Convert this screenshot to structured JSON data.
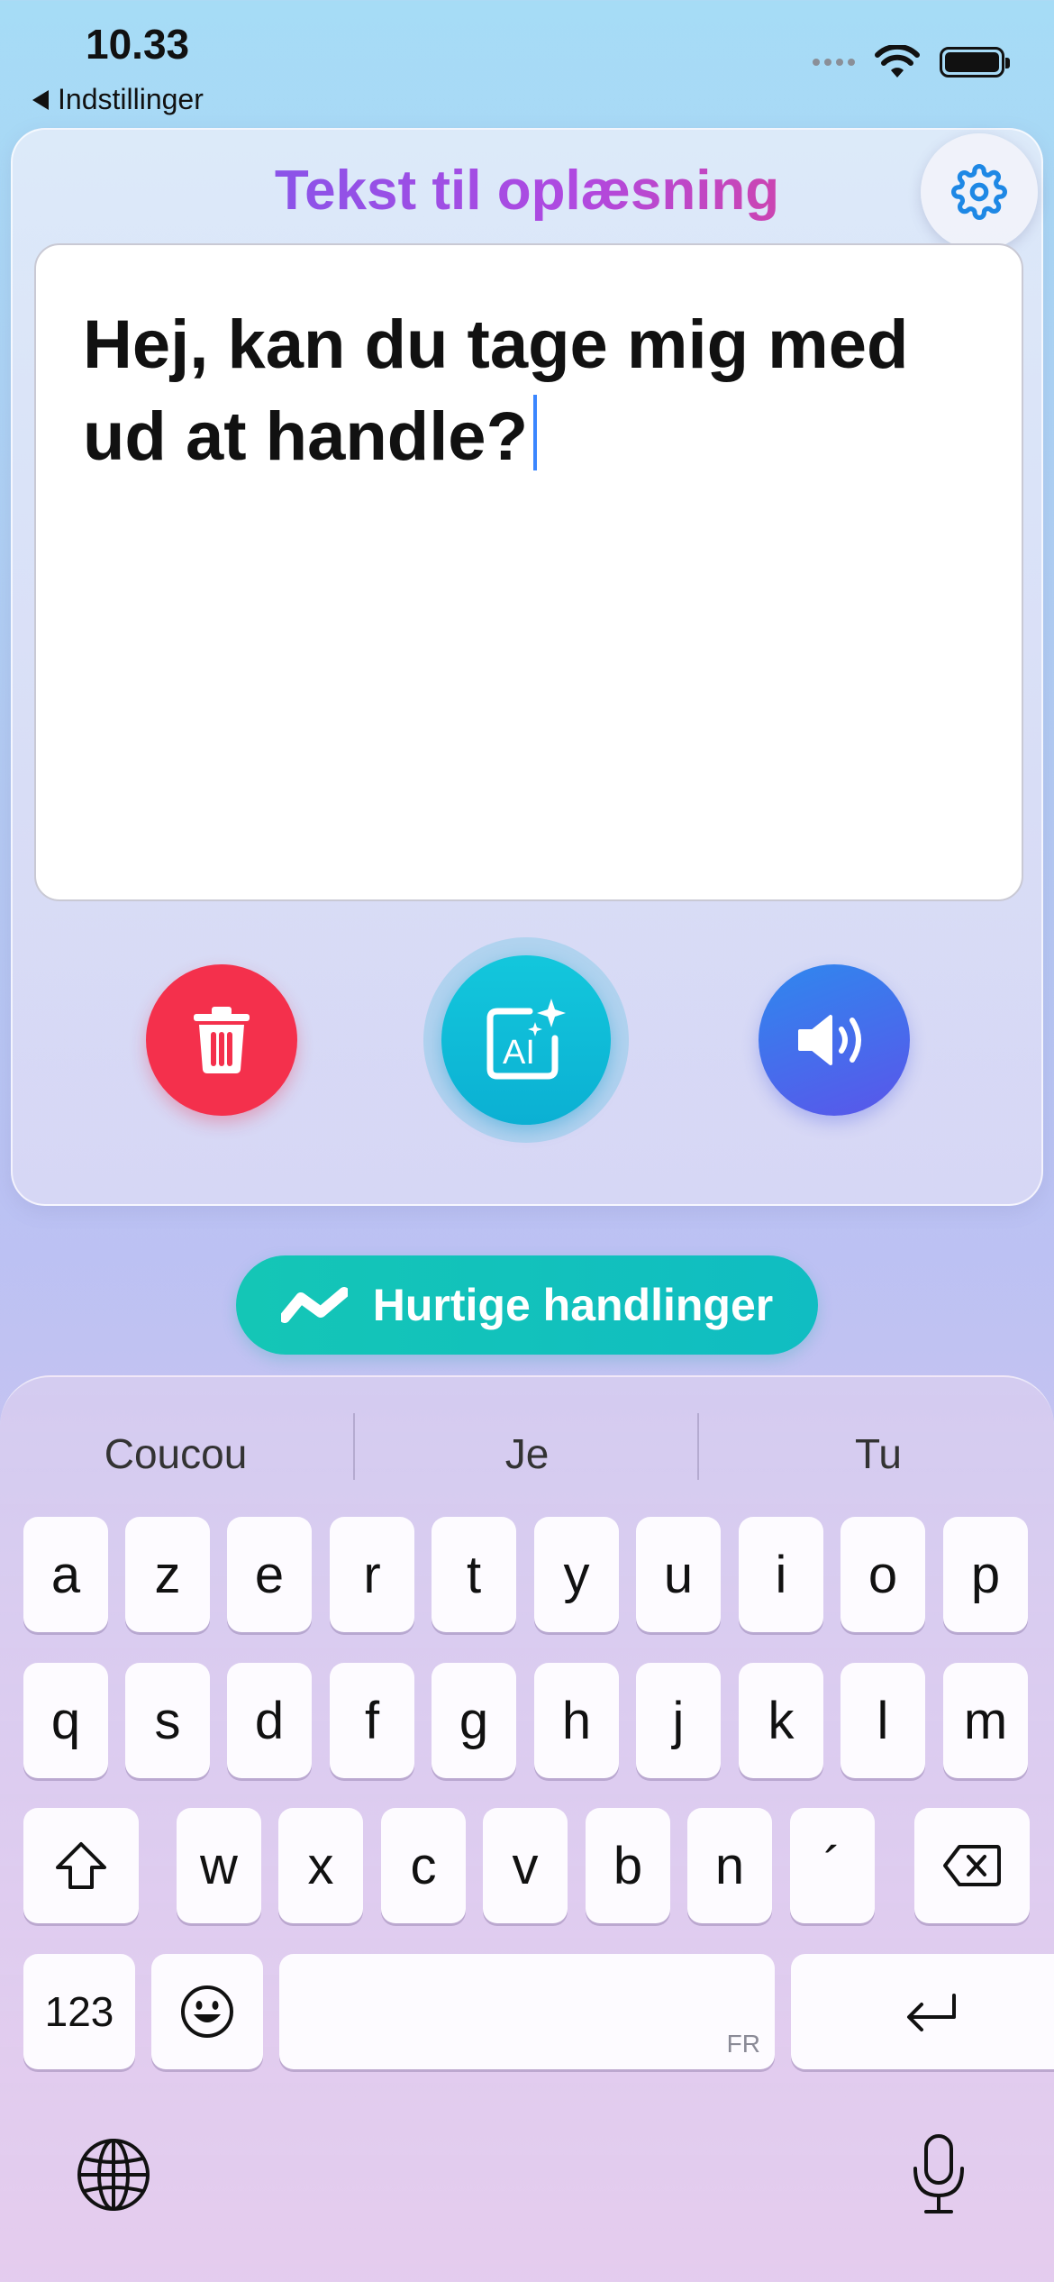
{
  "status_bar": {
    "time": "10.33",
    "back_label": "Indstillinger"
  },
  "app": {
    "title": "Tekst til oplæsning",
    "text_value": "Hej, kan du tage mig med ud at handle?",
    "icons": {
      "settings": "gear-icon",
      "delete": "trash-icon",
      "ai": "ai-sparkle-icon",
      "speak": "speaker-icon"
    },
    "colors": {
      "delete": "#f4304c",
      "ai": "#13c7dc",
      "speak": "#3d74ee",
      "quick": "#14c6b6"
    }
  },
  "quick_actions": {
    "label": "Hurtige handlinger"
  },
  "keyboard": {
    "suggestions": [
      "Coucou",
      "Je",
      "Tu"
    ],
    "row1": [
      "a",
      "z",
      "e",
      "r",
      "t",
      "y",
      "u",
      "i",
      "o",
      "p"
    ],
    "row2": [
      "q",
      "s",
      "d",
      "f",
      "g",
      "h",
      "j",
      "k",
      "l",
      "m"
    ],
    "row3": [
      "w",
      "x",
      "c",
      "v",
      "b",
      "n",
      "´"
    ],
    "numbers_label": "123",
    "space_language": "FR"
  }
}
